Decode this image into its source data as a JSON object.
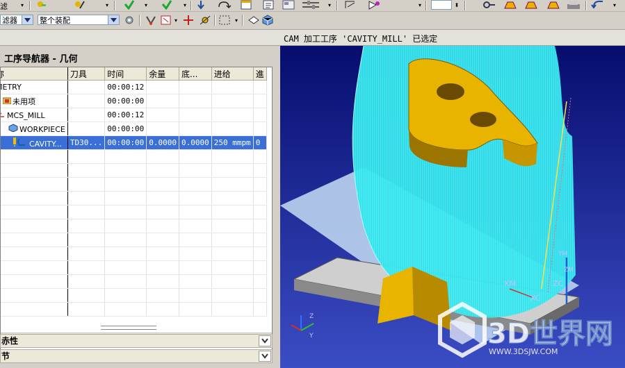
{
  "toolbar1": {
    "left_label": "滤",
    "icons": [
      "yellow-tool-icon",
      "green-check-icon",
      "green-check-icon",
      "arrow-down-icon",
      "loop-icon",
      "window-icon",
      "list-icon",
      "slider-icon",
      "arrow-icon",
      "pointer-icon",
      "blue-box-icon",
      "wrench-icon",
      "gold-icon",
      "gold-icon",
      "gold-icon",
      "print-icon",
      "undo-icon"
    ]
  },
  "toolbar2": {
    "filter_label": "滤器",
    "assembly_select": "整个装配"
  },
  "status": {
    "message": "CAM 加工工序 'CAVITY_MILL' 已选定"
  },
  "navigator": {
    "title": "工序导航器 - 几何",
    "columns": [
      "称",
      "刀具",
      "时间",
      "余量",
      "底...",
      "进给",
      "進"
    ],
    "rows": [
      {
        "name": "METRY",
        "tool": "",
        "time": "00:00:12",
        "stock": "",
        "floor": "",
        "feed": "",
        "extra": "",
        "icon": ""
      },
      {
        "name": "未用项",
        "tool": "",
        "time": "00:00:00",
        "stock": "",
        "floor": "",
        "feed": "",
        "extra": "",
        "icon": "folder-icon"
      },
      {
        "name": "MCS_MILL",
        "tool": "",
        "time": "00:00:12",
        "stock": "",
        "floor": "",
        "feed": "",
        "extra": "",
        "icon": "axis-icon"
      },
      {
        "name": "WORKPIECE",
        "tool": "",
        "time": "00:00:00",
        "stock": "",
        "floor": "",
        "feed": "",
        "extra": "",
        "icon": "cube-icon"
      },
      {
        "name": "CAVITY...",
        "tool": "TD30...",
        "time": "00:00:00",
        "stock": "0.0000",
        "floor": "0.0000",
        "feed": "250 mmpm",
        "extra": "0",
        "icon": "operation-icon",
        "selected": true
      }
    ],
    "empty_rows": 12
  },
  "sections": {
    "properties": "赤性",
    "details": "节"
  },
  "viewport": {
    "axis_labels": {
      "xm": "XM",
      "zc": "ZC",
      "xc": "XC",
      "ym": "YM",
      "zm": "ZM"
    },
    "triad_labels": {
      "z": "Z",
      "y": "Y"
    },
    "watermark_title": "3D世界网",
    "watermark_url": "WWW.3DSJW.COM",
    "colors": {
      "background_top": "#060d6e",
      "background_bottom": "#3b4dc4",
      "toolpath": "#30e6ee",
      "part": "#e8b400",
      "plate": "#b8cfee"
    }
  }
}
